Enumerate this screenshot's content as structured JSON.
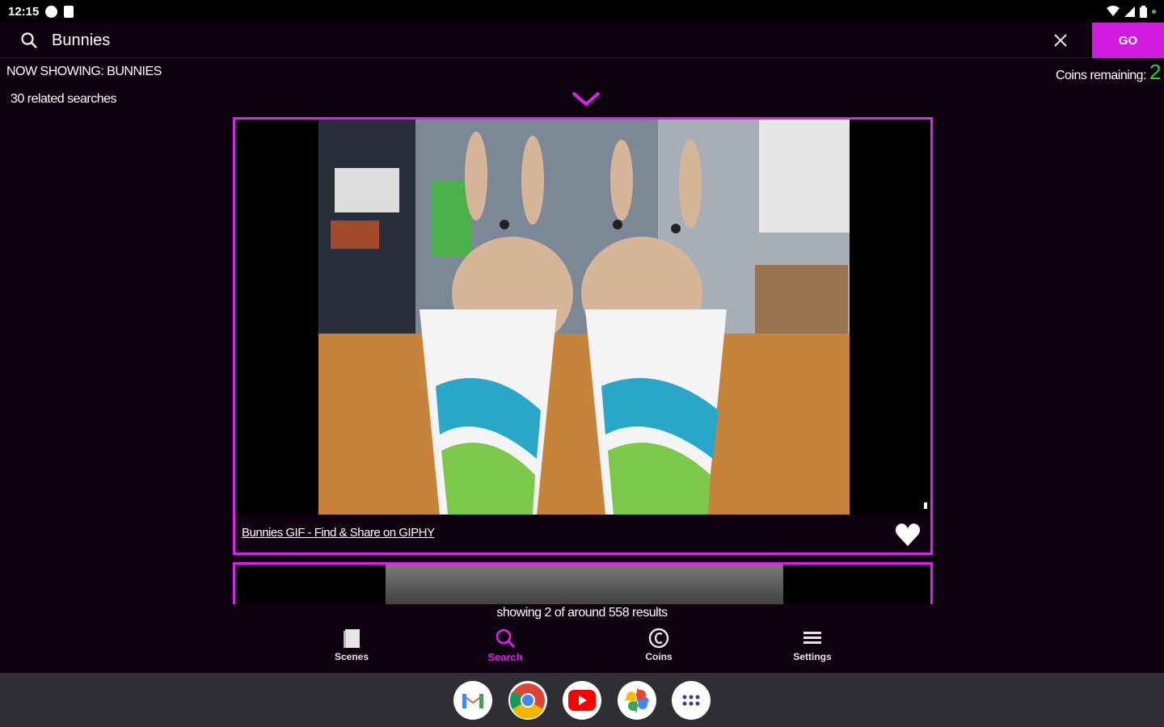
{
  "status_bar": {
    "time": "12:15"
  },
  "search": {
    "value": "Bunnies",
    "placeholder": "",
    "go_label": "GO"
  },
  "header": {
    "now_showing": "NOW SHOWING: BUNNIES",
    "related_searches": "30 related searches",
    "coins_label": "Coins remaining:",
    "coins_count": "2"
  },
  "result": {
    "caption": "Bunnies GIF - Find & Share on GIPHY"
  },
  "results_count": "showing 2 of around 558 results",
  "nav": {
    "items": [
      {
        "label": "Scenes",
        "icon": "scenes-icon"
      },
      {
        "label": "Search",
        "icon": "search-icon",
        "active": true
      },
      {
        "label": "Coins",
        "icon": "coins-icon"
      },
      {
        "label": "Settings",
        "icon": "menu-icon"
      }
    ]
  },
  "dock": {
    "apps": [
      "gmail-icon",
      "chrome-icon",
      "youtube-icon",
      "photos-icon",
      "app-drawer-icon"
    ]
  },
  "colors": {
    "accent": "#e01ff0",
    "background": "#0e000f",
    "coins": "#2ecc40"
  }
}
